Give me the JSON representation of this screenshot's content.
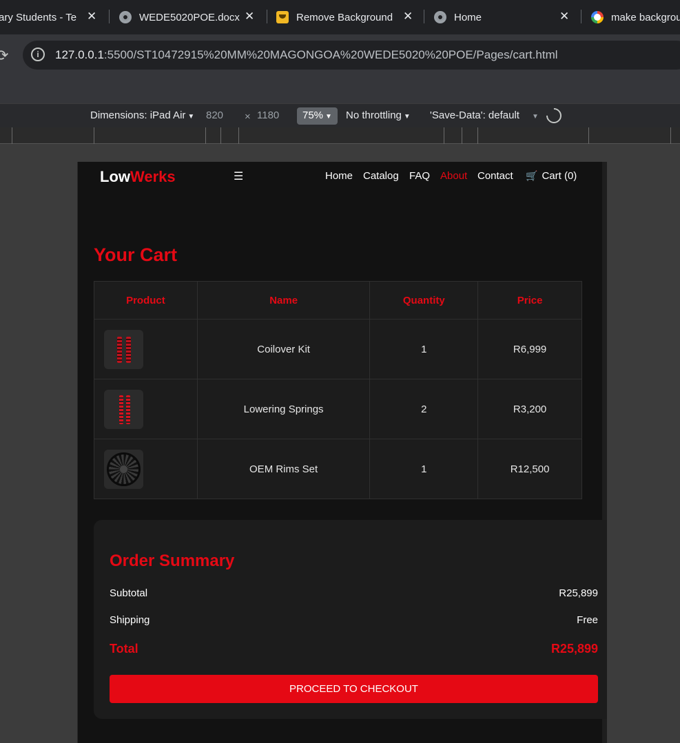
{
  "browser": {
    "tabs": [
      {
        "title": "ary Students - Te",
        "icon": "teams-icon"
      },
      {
        "title": "WEDE5020POE.docx",
        "icon": "globe-icon"
      },
      {
        "title": "Remove Background",
        "icon": "remove-bg-icon"
      },
      {
        "title": "Home",
        "icon": "globe-icon"
      },
      {
        "title": "make backgrou",
        "icon": "google-icon"
      }
    ],
    "close_glyph": "✕",
    "url_host": "127.0.0.1",
    "url_path": ":5500/ST10472915%20MM%20MAGONGOA%20WEDE5020%20POE/Pages/cart.html"
  },
  "devtools": {
    "dimensions_label": "Dimensions: iPad Air",
    "width": "820",
    "times": "×",
    "height": "1180",
    "zoom": "75%",
    "throttling": "No throttling",
    "save_data": "'Save-Data': default"
  },
  "site": {
    "logo_part1": "Low",
    "logo_part2": "Werks",
    "menu_glyph": "☰",
    "nav": [
      "Home",
      "Catalog",
      "FAQ",
      "About",
      "Contact"
    ],
    "active_nav": "About",
    "cart_link": "Cart (0)",
    "accent_color": "#e50914"
  },
  "cart": {
    "title": "Your Cart",
    "headers": [
      "Product",
      "Name",
      "Quantity",
      "Price"
    ],
    "rows": [
      {
        "image": "coilover-kit-image",
        "name": "Coilover Kit",
        "quantity": "1",
        "price": "R6,999"
      },
      {
        "image": "lowering-springs-image",
        "name": "Lowering Springs",
        "quantity": "2",
        "price": "R3,200"
      },
      {
        "image": "oem-rims-image",
        "name": "OEM Rims Set",
        "quantity": "1",
        "price": "R12,500"
      }
    ]
  },
  "summary": {
    "title": "Order Summary",
    "subtotal_label": "Subtotal",
    "subtotal_value": "R25,899",
    "shipping_label": "Shipping",
    "shipping_value": "Free",
    "total_label": "Total",
    "total_value": "R25,899",
    "checkout_label": "PROCEED TO CHECKOUT"
  }
}
